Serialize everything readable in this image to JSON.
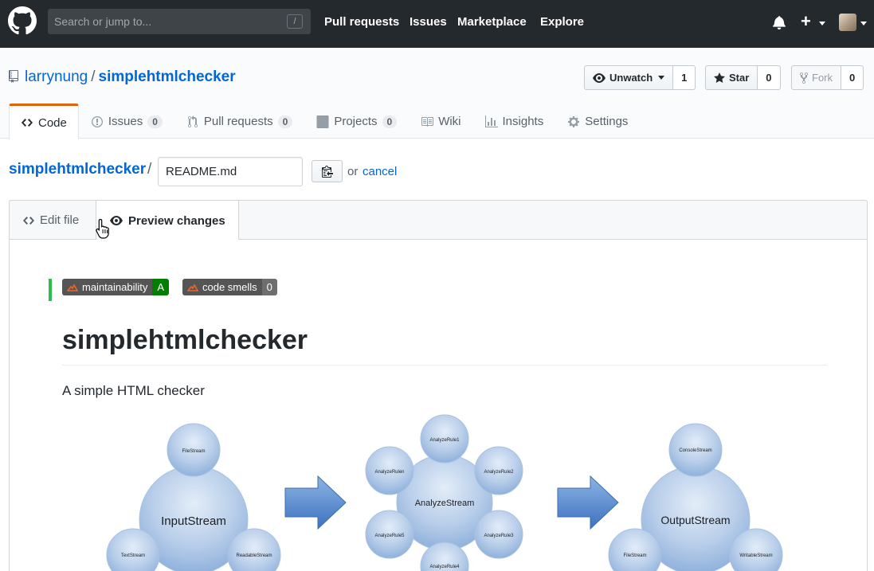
{
  "header": {
    "search_placeholder": "Search or jump to...",
    "search_shortcut": "/",
    "nav": [
      "Pull requests",
      "Issues",
      "Marketplace",
      "Explore"
    ],
    "plus_label": "+"
  },
  "repo": {
    "owner": "larrynung",
    "separator": "/",
    "name": "simplehtmlchecker",
    "watch": {
      "label": "Unwatch",
      "count": "1"
    },
    "star": {
      "label": "Star",
      "count": "0"
    },
    "fork": {
      "label": "Fork",
      "count": "0"
    }
  },
  "reponav": {
    "code": {
      "label": "Code"
    },
    "issues": {
      "label": "Issues",
      "count": "0"
    },
    "pulls": {
      "label": "Pull requests",
      "count": "0"
    },
    "projects": {
      "label": "Projects",
      "count": "0"
    },
    "wiki": {
      "label": "Wiki"
    },
    "insights": {
      "label": "Insights"
    },
    "settings": {
      "label": "Settings"
    }
  },
  "editor": {
    "breadcrumb_repo": "simplehtmlchecker",
    "breadcrumb_sep": "/",
    "filename": "README.md",
    "or_text": "or",
    "cancel": "cancel",
    "tab_edit": "Edit file",
    "tab_preview": "Preview changes"
  },
  "preview": {
    "badges": [
      {
        "label": "maintainability",
        "value": "A",
        "color": "#007e00"
      },
      {
        "label": "code smells",
        "value": "0",
        "color": "#6e6e6e"
      }
    ],
    "title": "simplehtmlchecker",
    "description": "A simple HTML checker"
  },
  "diagram": {
    "groups": [
      {
        "center": "InputStream",
        "satellites": [
          "FileStream",
          "TextStream",
          "ReadableStream"
        ]
      },
      {
        "center": "AnalyzeStream",
        "satellites": [
          "AnalyzeRule1",
          "AnalyzeRule2",
          "AnalyzeRule3",
          "AnalyzeRule4",
          "AnalyzeRule5",
          "AnalyzeRulen"
        ]
      },
      {
        "center": "OutputStream",
        "satellites": [
          "ConsoleStream",
          "FileStream",
          "WritableStream"
        ]
      }
    ]
  },
  "colors": {
    "header_bg": "#24292e",
    "link": "#0366d6",
    "tab_accent": "#e36209",
    "diff_added": "#2cbe4e"
  }
}
